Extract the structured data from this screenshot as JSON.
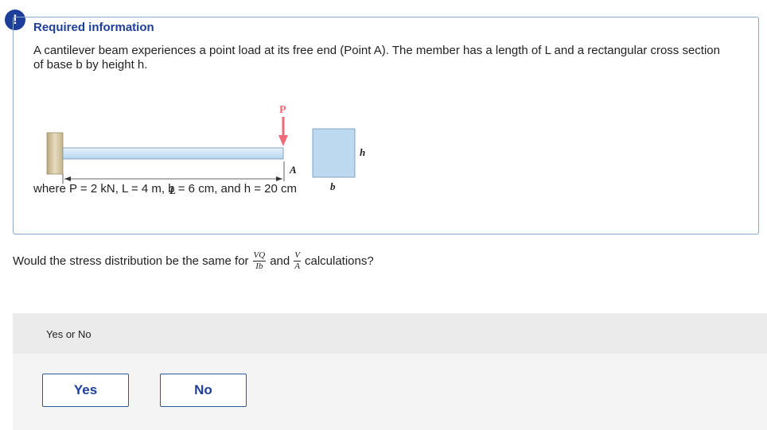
{
  "header": {
    "alert_glyph": "!",
    "title": "Required information",
    "description": "A cantilever beam experiences a point load at its free end (Point A). The member has a length of L and a rectangular cross section of base b by height h."
  },
  "figure": {
    "load_label": "P",
    "point_label": "A",
    "length_label": "L",
    "height_label": "h",
    "base_label": "b"
  },
  "given": "where P = 2 kN, L = 4 m, b = 6 cm, and h = 20 cm",
  "question": {
    "prefix": "Would the stress distribution be the same for",
    "frac1_num": "VQ",
    "frac1_den": "Ib",
    "connector": "and",
    "frac2_num": "V",
    "frac2_den": "A",
    "suffix": "calculations?"
  },
  "answer": {
    "label": "Yes or No",
    "options": [
      "Yes",
      "No"
    ]
  },
  "colors": {
    "accent": "#1e3f99",
    "load_arrow": "#f06a7a",
    "beam": "#cfe5f5",
    "section": "#bcd9ef",
    "wall": "#d8cba8"
  }
}
